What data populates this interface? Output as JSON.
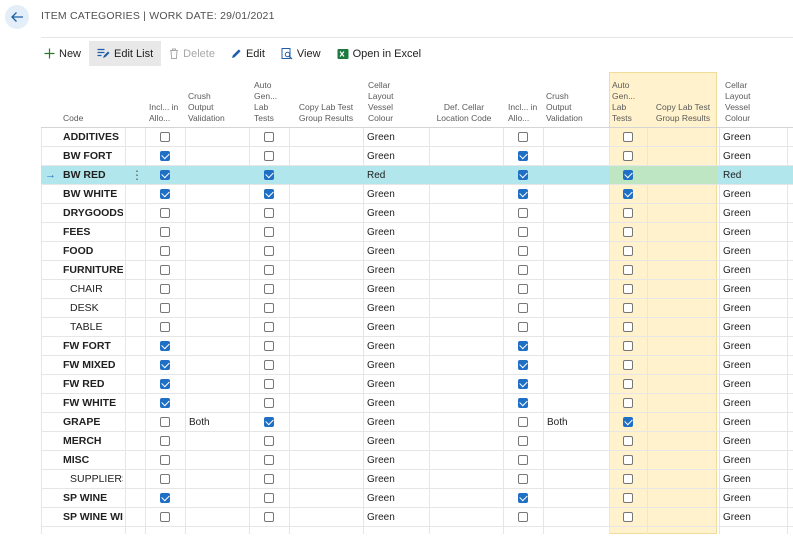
{
  "header": {
    "title": "ITEM CATEGORIES | WORK DATE: 29/01/2021"
  },
  "toolbar": {
    "new": "New",
    "edit_list": "Edit List",
    "delete": "Delete",
    "edit": "Edit",
    "view": "View",
    "open_excel": "Open in Excel"
  },
  "columns": {
    "code": "Code",
    "incl_alloc": "Incl... in Allo...",
    "crush_output": "Crush Output Validation",
    "auto_gen": "Auto Gen... Lab Tests",
    "copy_lab": "Copy Lab Test Group Results",
    "cellar_colour": "Cellar Layout Vessel Colour",
    "def_cellar": "Def. Cellar Location Code",
    "incl_alloc2": "Incl... in Allo...",
    "crush_output2": "Crush Output Validation",
    "auto_gen2": "Auto Gen... Lab Tests",
    "copy_lab2": "Copy Lab Test Group Results",
    "cellar_colour2": "Cellar Layout Vessel Colour"
  },
  "colors": {
    "selected_row": "#b1e6ec",
    "highlight_band": "#fff2cc",
    "checkbox_on": "#1f6fc5"
  },
  "rows": [
    {
      "code": "ADDITIVES",
      "child": false,
      "incl": false,
      "crush": "",
      "auto": false,
      "colour": "Green",
      "incl2": false,
      "crush2": "",
      "auto2": false,
      "colour2": "Green"
    },
    {
      "code": "BW FORT",
      "child": false,
      "incl": true,
      "crush": "",
      "auto": false,
      "colour": "Green",
      "incl2": true,
      "crush2": "",
      "auto2": false,
      "colour2": "Green"
    },
    {
      "code": "BW RED",
      "child": false,
      "selected": true,
      "incl": true,
      "crush": "",
      "auto": true,
      "colour": "Red",
      "incl2": true,
      "crush2": "",
      "auto2": true,
      "colour2": "Red"
    },
    {
      "code": "BW WHITE",
      "child": false,
      "incl": true,
      "crush": "",
      "auto": true,
      "colour": "Green",
      "incl2": true,
      "crush2": "",
      "auto2": true,
      "colour2": "Green"
    },
    {
      "code": "DRYGOODS",
      "child": false,
      "incl": false,
      "crush": "",
      "auto": false,
      "colour": "Green",
      "incl2": false,
      "crush2": "",
      "auto2": false,
      "colour2": "Green"
    },
    {
      "code": "FEES",
      "child": false,
      "incl": false,
      "crush": "",
      "auto": false,
      "colour": "Green",
      "incl2": false,
      "crush2": "",
      "auto2": false,
      "colour2": "Green"
    },
    {
      "code": "FOOD",
      "child": false,
      "incl": false,
      "crush": "",
      "auto": false,
      "colour": "Green",
      "incl2": false,
      "crush2": "",
      "auto2": false,
      "colour2": "Green"
    },
    {
      "code": "FURNITURE",
      "child": false,
      "incl": false,
      "crush": "",
      "auto": false,
      "colour": "Green",
      "incl2": false,
      "crush2": "",
      "auto2": false,
      "colour2": "Green"
    },
    {
      "code": "CHAIR",
      "child": true,
      "incl": false,
      "crush": "",
      "auto": false,
      "colour": "Green",
      "incl2": false,
      "crush2": "",
      "auto2": false,
      "colour2": "Green"
    },
    {
      "code": "DESK",
      "child": true,
      "incl": false,
      "crush": "",
      "auto": false,
      "colour": "Green",
      "incl2": false,
      "crush2": "",
      "auto2": false,
      "colour2": "Green"
    },
    {
      "code": "TABLE",
      "child": true,
      "incl": false,
      "crush": "",
      "auto": false,
      "colour": "Green",
      "incl2": false,
      "crush2": "",
      "auto2": false,
      "colour2": "Green"
    },
    {
      "code": "FW FORT",
      "child": false,
      "incl": true,
      "crush": "",
      "auto": false,
      "colour": "Green",
      "incl2": true,
      "crush2": "",
      "auto2": false,
      "colour2": "Green"
    },
    {
      "code": "FW MIXED",
      "child": false,
      "incl": true,
      "crush": "",
      "auto": false,
      "colour": "Green",
      "incl2": true,
      "crush2": "",
      "auto2": false,
      "colour2": "Green"
    },
    {
      "code": "FW RED",
      "child": false,
      "incl": true,
      "crush": "",
      "auto": false,
      "colour": "Green",
      "incl2": true,
      "crush2": "",
      "auto2": false,
      "colour2": "Green"
    },
    {
      "code": "FW WHITE",
      "child": false,
      "incl": true,
      "crush": "",
      "auto": false,
      "colour": "Green",
      "incl2": true,
      "crush2": "",
      "auto2": false,
      "colour2": "Green"
    },
    {
      "code": "GRAPE",
      "child": false,
      "incl": false,
      "crush": "Both",
      "auto": true,
      "colour": "Green",
      "incl2": false,
      "crush2": "Both",
      "auto2": true,
      "colour2": "Green"
    },
    {
      "code": "MERCH",
      "child": false,
      "incl": false,
      "crush": "",
      "auto": false,
      "colour": "Green",
      "incl2": false,
      "crush2": "",
      "auto2": false,
      "colour2": "Green"
    },
    {
      "code": "MISC",
      "child": false,
      "incl": false,
      "crush": "",
      "auto": false,
      "colour": "Green",
      "incl2": false,
      "crush2": "",
      "auto2": false,
      "colour2": "Green"
    },
    {
      "code": "SUPPLIERS",
      "child": true,
      "incl": false,
      "crush": "",
      "auto": false,
      "colour": "Green",
      "incl2": false,
      "crush2": "",
      "auto2": false,
      "colour2": "Green"
    },
    {
      "code": "SP WINE",
      "child": false,
      "incl": true,
      "crush": "",
      "auto": false,
      "colour": "Green",
      "incl2": true,
      "crush2": "",
      "auto2": false,
      "colour2": "Green"
    },
    {
      "code": "SP WINE WI",
      "child": false,
      "incl": false,
      "crush": "",
      "auto": false,
      "colour": "Green",
      "incl2": false,
      "crush2": "",
      "auto2": false,
      "colour2": "Green"
    }
  ]
}
